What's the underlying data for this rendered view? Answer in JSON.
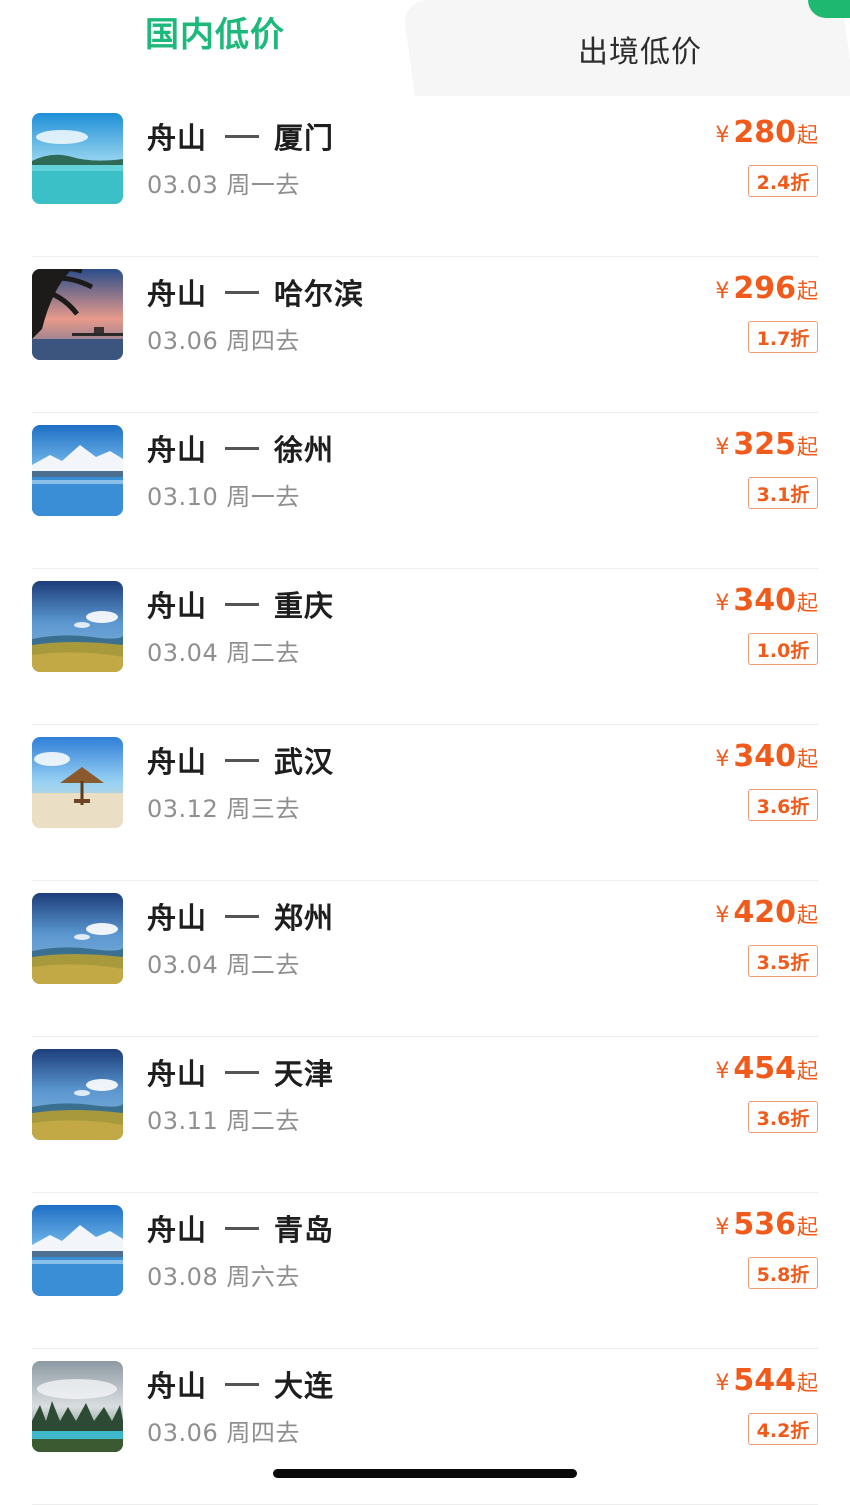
{
  "tabs": {
    "domestic": "国内低价",
    "international": "出境低价"
  },
  "colors": {
    "active_tab": "#1cb97b",
    "price": "#f05a1a",
    "accent": "#1fb870"
  },
  "routes": [
    {
      "from": "舟山",
      "to": "厦门",
      "date": "03.03 周一去",
      "currency": "¥",
      "price": "280",
      "suffix": "起",
      "discount": "2.4折",
      "image": "seaside-lake"
    },
    {
      "from": "舟山",
      "to": "哈尔滨",
      "date": "03.06 周四去",
      "currency": "¥",
      "price": "296",
      "suffix": "起",
      "discount": "1.7折",
      "image": "palm-sunset"
    },
    {
      "from": "舟山",
      "to": "徐州",
      "date": "03.10 周一去",
      "currency": "¥",
      "price": "325",
      "suffix": "起",
      "discount": "3.1折",
      "image": "snow-mountain-lake"
    },
    {
      "from": "舟山",
      "to": "重庆",
      "date": "03.04 周二去",
      "currency": "¥",
      "price": "340",
      "suffix": "起",
      "discount": "1.0折",
      "image": "grassland-lake"
    },
    {
      "from": "舟山",
      "to": "武汉",
      "date": "03.12 周三去",
      "currency": "¥",
      "price": "340",
      "suffix": "起",
      "discount": "3.6折",
      "image": "beach-umbrella"
    },
    {
      "from": "舟山",
      "to": "郑州",
      "date": "03.04 周二去",
      "currency": "¥",
      "price": "420",
      "suffix": "起",
      "discount": "3.5折",
      "image": "grassland-lake"
    },
    {
      "from": "舟山",
      "to": "天津",
      "date": "03.11 周二去",
      "currency": "¥",
      "price": "454",
      "suffix": "起",
      "discount": "3.6折",
      "image": "grassland-lake"
    },
    {
      "from": "舟山",
      "to": "青岛",
      "date": "03.08 周六去",
      "currency": "¥",
      "price": "536",
      "suffix": "起",
      "discount": "5.8折",
      "image": "snow-mountain-lake"
    },
    {
      "from": "舟山",
      "to": "大连",
      "date": "03.06 周四去",
      "currency": "¥",
      "price": "544",
      "suffix": "起",
      "discount": "4.2折",
      "image": "forest-mist"
    }
  ]
}
